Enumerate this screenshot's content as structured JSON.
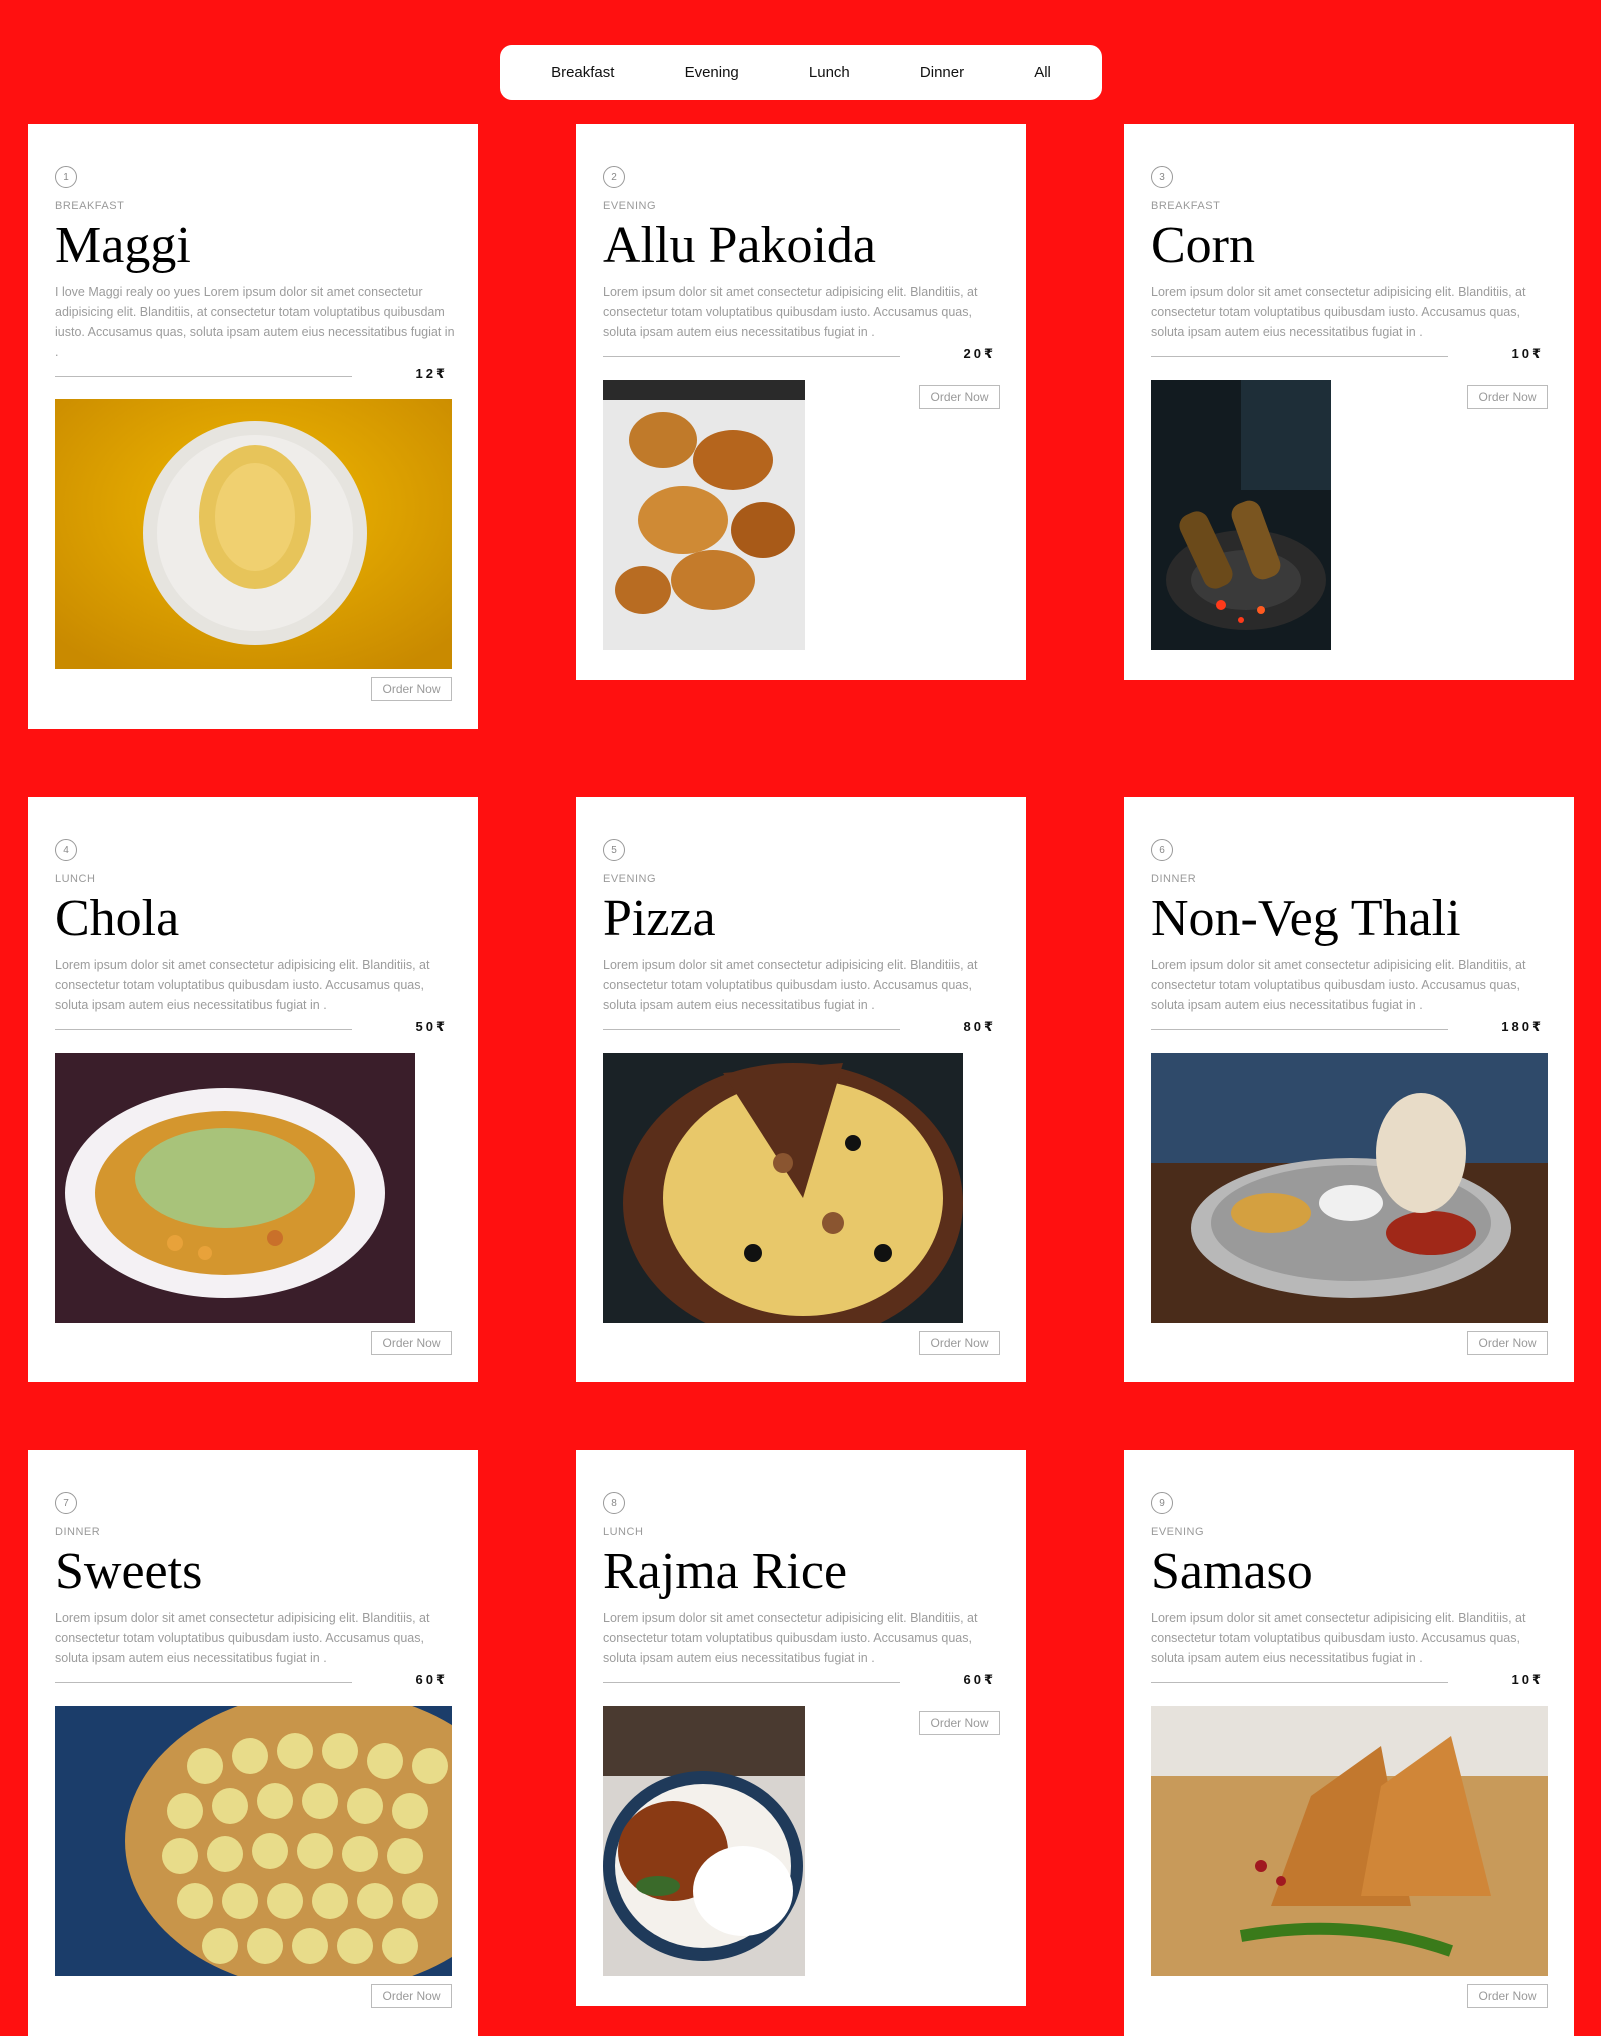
{
  "tabs": [
    "Breakfast",
    "Evening",
    "Lunch",
    "Dinner",
    "All"
  ],
  "order_label": "Order Now",
  "cards": [
    {
      "num": "1",
      "category": "BREAKFAST",
      "title": "Maggi",
      "desc": "I love Maggi realy oo yues Lorem ipsum dolor sit amet consectetur adipisicing elit. Blanditiis, at consectetur totam voluptatibus quibusdam iusto. Accusamus quas, soluta ipsam autem eius necessitatibus fugiat in .",
      "price": "12₹",
      "image": "maggi-noodles-plate"
    },
    {
      "num": "2",
      "category": "EVENING",
      "title": "Allu Pakoida",
      "desc": "Lorem ipsum dolor sit amet consectetur adipisicing elit. Blanditiis, at consectetur totam voluptatibus quibusdam iusto. Accusamus quas, soluta ipsam autem eius necessitatibus fugiat in .",
      "price": "20₹",
      "image": "pakoda-basket"
    },
    {
      "num": "3",
      "category": "BREAKFAST",
      "title": "Corn",
      "desc": "Lorem ipsum dolor sit amet consectetur adipisicing elit. Blanditiis, at consectetur totam voluptatibus quibusdam iusto. Accusamus quas, soluta ipsam autem eius necessitatibus fugiat in .",
      "price": "10₹",
      "image": "roasted-corn"
    },
    {
      "num": "4",
      "category": "LUNCH",
      "title": "Chola",
      "desc": "Lorem ipsum dolor sit amet consectetur adipisicing elit. Blanditiis, at consectetur totam voluptatibus quibusdam iusto. Accusamus quas, soluta ipsam autem eius necessitatibus fugiat in .",
      "price": "50₹",
      "image": "chola-plate"
    },
    {
      "num": "5",
      "category": "EVENING",
      "title": "Pizza",
      "desc": "Lorem ipsum dolor sit amet consectetur adipisicing elit. Blanditiis, at consectetur totam voluptatibus quibusdam iusto. Accusamus quas, soluta ipsam autem eius necessitatibus fugiat in .",
      "price": "80₹",
      "image": "pizza"
    },
    {
      "num": "6",
      "category": "DINNER",
      "title": "Non-Veg Thali",
      "desc": "Lorem ipsum dolor sit amet consectetur adipisicing elit. Blanditiis, at consectetur totam voluptatibus quibusdam iusto. Accusamus quas, soluta ipsam autem eius necessitatibus fugiat in .",
      "price": "180₹",
      "image": "thali-plate"
    },
    {
      "num": "7",
      "category": "DINNER",
      "title": "Sweets",
      "desc": "Lorem ipsum dolor sit amet consectetur adipisicing elit. Blanditiis, at consectetur totam voluptatibus quibusdam iusto. Accusamus quas, soluta ipsam autem eius necessitatibus fugiat in .",
      "price": "60₹",
      "image": "sweets-tray"
    },
    {
      "num": "8",
      "category": "LUNCH",
      "title": "Rajma Rice",
      "desc": "Lorem ipsum dolor sit amet consectetur adipisicing elit. Blanditiis, at consectetur totam voluptatibus quibusdam iusto. Accusamus quas, soluta ipsam autem eius necessitatibus fugiat in .",
      "price": "60₹",
      "image": "rajma-rice-bowl"
    },
    {
      "num": "9",
      "category": "EVENING",
      "title": "Samaso",
      "desc": "Lorem ipsum dolor sit amet consectetur adipisicing elit. Blanditiis, at consectetur totam voluptatibus quibusdam iusto. Accusamus quas, soluta ipsam autem eius necessitatibus fugiat in .",
      "price": "10₹",
      "image": "samosa-board"
    }
  ]
}
